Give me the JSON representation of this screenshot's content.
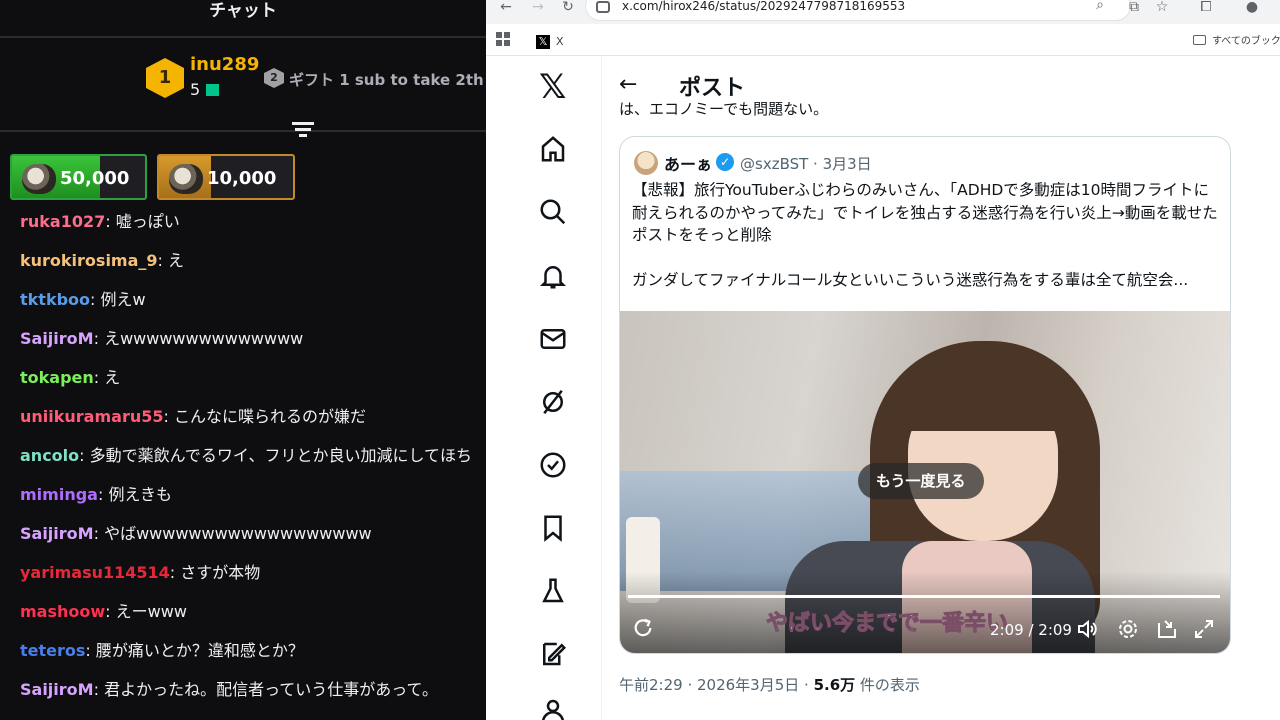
{
  "chat": {
    "title": "チャット",
    "top_gifter": {
      "rank": "1",
      "name": "inu289",
      "count": "5"
    },
    "gift_rank": "2",
    "gift_text": "ギフト 1 sub to take 2th",
    "bits": [
      {
        "amount": "50,000"
      },
      {
        "amount": "10,000"
      }
    ],
    "messages": [
      {
        "user": "ruka1027",
        "color": "#ff6b8a",
        "text": "嘘っぽい"
      },
      {
        "user": "kurokirosima_9",
        "color": "#f5c07a",
        "text": "え"
      },
      {
        "user": "tktkboo",
        "color": "#5a9be8",
        "text": "例えw"
      },
      {
        "user": "SaijiroM",
        "color": "#d7a3ff",
        "text": "えwwwwwwwwwwwwww"
      },
      {
        "user": "tokapen",
        "color": "#7cf05a",
        "text": "え"
      },
      {
        "user": "uniikuramaru55",
        "color": "#ff5c7a",
        "text": "こんなに喋られるのが嫌だ"
      },
      {
        "user": "ancolo",
        "color": "#7fe0c8",
        "text": "多動で薬飲んでるワイ、フリとか良い加減にしてほち"
      },
      {
        "user": "miminga",
        "color": "#b06cff",
        "text": "例えきも"
      },
      {
        "user": "SaijiroM",
        "color": "#d7a3ff",
        "text": "やばwwwwwwwwwwwwwwwwww"
      },
      {
        "user": "yarimasu114514",
        "color": "#e8283a",
        "text": "さすが本物"
      },
      {
        "user": "mashoow",
        "color": "#ff3050",
        "text": "えーwww"
      },
      {
        "user": "teteros",
        "color": "#4a7ee8",
        "text": "腰が痛いとか？違和感とか？"
      },
      {
        "user": "SaijiroM",
        "color": "#d7a3ff",
        "text": "君よかったね。配信者っていう仕事があって。"
      }
    ]
  },
  "browser": {
    "url": "x.com/hirox246/status/2029247798718169553",
    "bookmark_x": "X",
    "bookmark_folder": "すべてのブックマーク"
  },
  "post": {
    "header": "ポスト",
    "cut_text": "は、エコノミーでも問題ない。",
    "quote": {
      "name": "あーぁ",
      "handle_date": "@sxzBST · 3月3日",
      "body": "【悲報】旅行YouTuberふじわらのみいさん、「ADHDで多動症は10時間フライトに耐えられるのかやってみた」でトイレを独占する迷惑行為を行い炎上→動画を載せたポストをそっと削除",
      "body2": "ガンダしてファイナルコール女といいこういう迷惑行為をする輩は全て航空会..."
    },
    "video": {
      "replay": "もう一度見る",
      "caption": "やばい今までで一番辛い",
      "time": "2:09 / 2:09",
      "progress": 1.0
    },
    "meta_time": "午前2:29 · 2026年3月5日 · ",
    "meta_views": "5.6万",
    "meta_views_suffix": " 件の表示"
  }
}
